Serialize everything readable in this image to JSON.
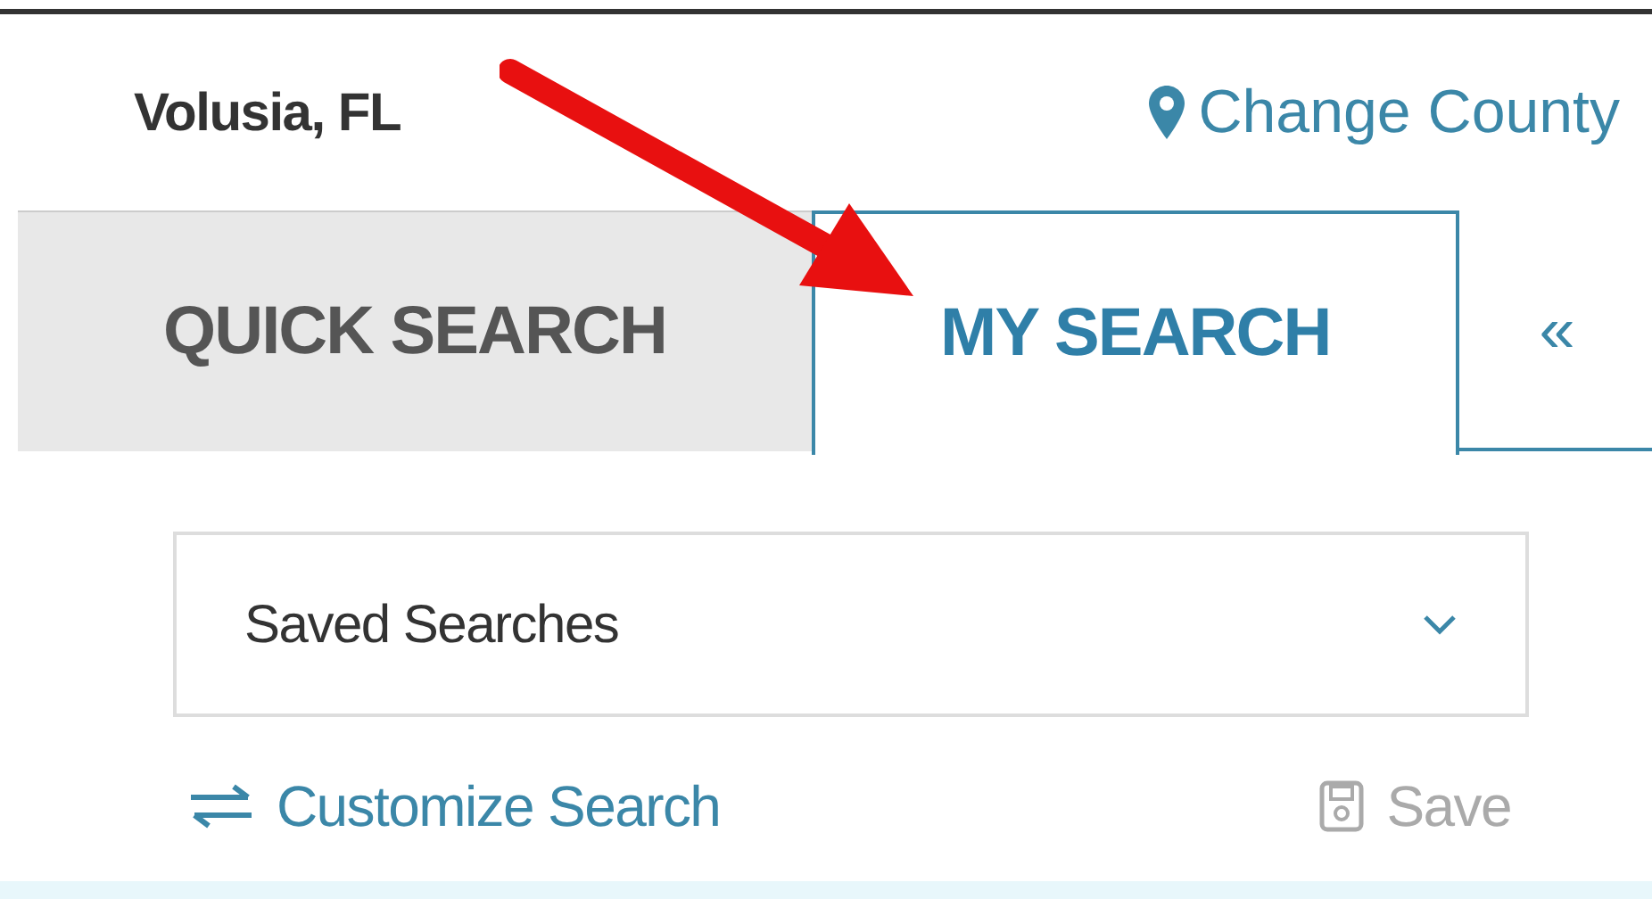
{
  "header": {
    "county": "Volusia, FL",
    "change_link": "Change County"
  },
  "tabs": [
    {
      "label": "QUICK SEARCH",
      "selected": false
    },
    {
      "label": "MY SEARCH",
      "selected": true
    }
  ],
  "collapse_toggle": "«",
  "saved_searches": {
    "value": "Saved Searches"
  },
  "actions": [
    {
      "kind": "customize",
      "label": "Customize Search",
      "disabled": false
    },
    {
      "kind": "save",
      "label": "Save",
      "disabled": true
    }
  ],
  "annotation": {
    "kind": "arrow"
  }
}
